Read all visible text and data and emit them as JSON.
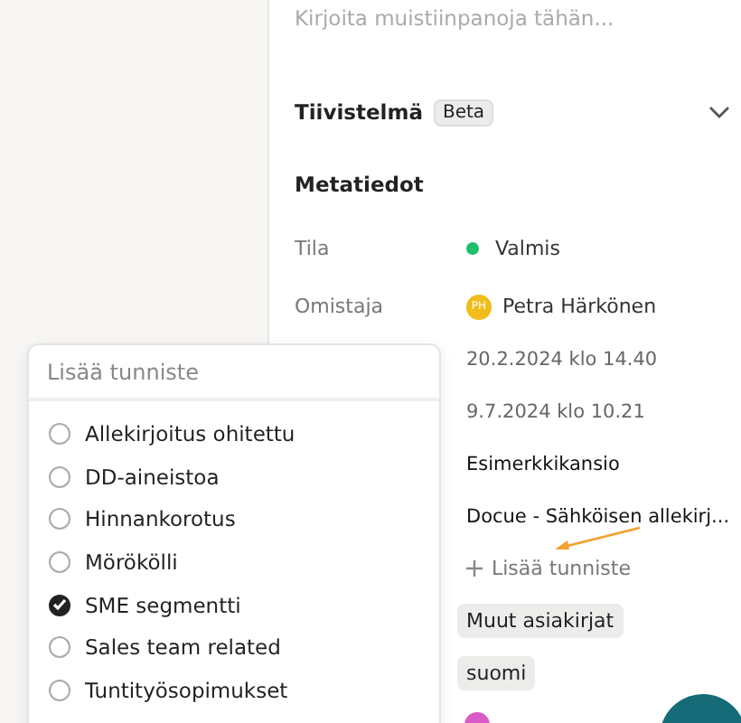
{
  "notes": {
    "placeholder": "Kirjoita muistiinpanoja tähän..."
  },
  "summary": {
    "title": "Tiivistelmä",
    "badge": "Beta",
    "expanded": false
  },
  "metadata": {
    "title": "Metatiedot",
    "rows": [
      {
        "kind": "status",
        "label": "Tila",
        "value": "Valmis",
        "color": "#1fbf6b"
      },
      {
        "kind": "person",
        "label": "Omistaja",
        "initials": "PH",
        "value": "Petra Härkönen"
      },
      {
        "kind": "text",
        "value": "20.2.2024 klo 14.40"
      },
      {
        "kind": "text",
        "value": "9.7.2024 klo 10.21"
      },
      {
        "kind": "strong",
        "value": "Esimerkkikansio"
      },
      {
        "kind": "strong",
        "value": "Docue - Sähköisen allekirj..."
      },
      {
        "kind": "add",
        "value": "Lisää tunniste"
      },
      {
        "kind": "chip",
        "value": "Muut asiakirjat"
      },
      {
        "kind": "chip",
        "value": "suomi"
      }
    ]
  },
  "tag_dropdown": {
    "placeholder": "Lisää tunniste",
    "options": [
      {
        "label": "Allekirjoitus ohitettu",
        "checked": false
      },
      {
        "label": "DD-aineistoa",
        "checked": false
      },
      {
        "label": "Hinnankorotus",
        "checked": false
      },
      {
        "label": "Mörökölli",
        "checked": false
      },
      {
        "label": "SME segmentti",
        "checked": true
      },
      {
        "label": "Sales team related",
        "checked": false
      },
      {
        "label": "Tuntityösopimukset",
        "checked": false
      }
    ]
  }
}
